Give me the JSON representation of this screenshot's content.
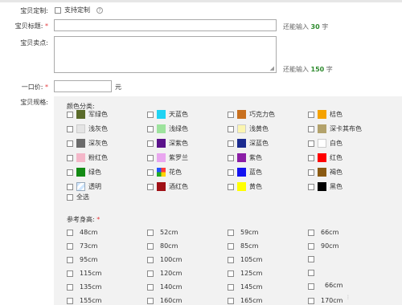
{
  "form": {
    "custom_label": "宝贝定制:",
    "custom_option": "支持定制",
    "help_icon": "question-circle-icon",
    "title_label": "宝贝标题:",
    "title_hint_pre": "还能输入",
    "title_hint_num": "30",
    "title_hint_post": "字",
    "selling_label": "宝贝卖点:",
    "selling_hint_pre": "还能输入",
    "selling_hint_num": "150",
    "selling_hint_post": "字",
    "price_label": "一口价:",
    "price_unit": "元",
    "spec_label": "宝贝规格:",
    "required_mark": "*"
  },
  "colors": {
    "section_title": "颜色分类:",
    "items": [
      {
        "name": "军绿色",
        "swatch": "#5a6b2a"
      },
      {
        "name": "天蓝色",
        "swatch": "#1fd3f3"
      },
      {
        "name": "巧克力色",
        "swatch": "#c8701f"
      },
      {
        "name": "桔色",
        "swatch": "#f5a200"
      },
      {
        "name": "浅灰色",
        "swatch": "#e4e4e4"
      },
      {
        "name": "浅绿色",
        "swatch": "#9de39d"
      },
      {
        "name": "浅黄色",
        "swatch": "#fbf5b0"
      },
      {
        "name": "深卡其布色",
        "swatch": "#b3a26b"
      },
      {
        "name": "深灰色",
        "swatch": "#6b6b6b"
      },
      {
        "name": "深紫色",
        "swatch": "#5a128a"
      },
      {
        "name": "深蓝色",
        "swatch": "#1b2b8f"
      },
      {
        "name": "白色",
        "swatch": "#ffffff"
      },
      {
        "name": "粉红色",
        "swatch": "#f4b7c9"
      },
      {
        "name": "紫罗兰",
        "swatch": "#e9a6ef"
      },
      {
        "name": "紫色",
        "swatch": "#8b1ea6"
      },
      {
        "name": "红色",
        "swatch": "#ff0000"
      },
      {
        "name": "绿色",
        "swatch": "#138a14"
      },
      {
        "name": "花色",
        "swatch": "multicolor"
      },
      {
        "name": "蓝色",
        "swatch": "#1313f0"
      },
      {
        "name": "褐色",
        "swatch": "#8a5a12"
      },
      {
        "name": "透明",
        "swatch": "transparent-pattern"
      },
      {
        "name": "酒红色",
        "swatch": "#a01016"
      },
      {
        "name": "黄色",
        "swatch": "#ffff00"
      },
      {
        "name": "黑色",
        "swatch": "#000000"
      }
    ],
    "select_all": "全选"
  },
  "sizes": {
    "section_title": "参考身高:",
    "col1": [
      "48cm",
      "73cm",
      "95cm",
      "115cm",
      "135cm",
      "155cm"
    ],
    "col2": [
      "52cm",
      "80cm",
      "100cm",
      "120cm",
      "140cm",
      "160cm"
    ],
    "col3": [
      "59cm",
      "85cm",
      "105cm",
      "125cm",
      "145cm",
      "165cm"
    ],
    "col4": [
      "66cm",
      "90cm",
      "",
      "",
      "",
      "170cm"
    ],
    "col4_extra": "66cm"
  }
}
